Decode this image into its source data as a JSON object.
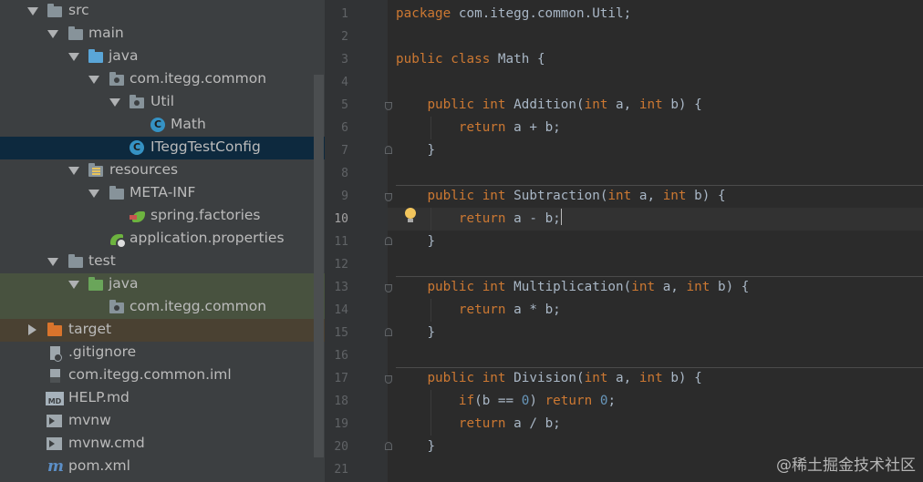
{
  "project_tree": {
    "items": [
      {
        "label": "src",
        "icon": "folder-icon"
      },
      {
        "label": "main",
        "icon": "folder-icon"
      },
      {
        "label": "java",
        "icon": "source-folder-icon"
      },
      {
        "label": "com.itegg.common",
        "icon": "package-icon"
      },
      {
        "label": "Util",
        "icon": "package-icon"
      },
      {
        "label": "Math",
        "icon": "class-icon"
      },
      {
        "label": "ITeggTestConfig",
        "icon": "class-icon"
      },
      {
        "label": "resources",
        "icon": "resources-folder-icon"
      },
      {
        "label": "META-INF",
        "icon": "folder-icon"
      },
      {
        "label": "spring.factories",
        "icon": "spring-factories-icon"
      },
      {
        "label": "application.properties",
        "icon": "spring-properties-icon"
      },
      {
        "label": "test",
        "icon": "folder-icon"
      },
      {
        "label": "java",
        "icon": "test-source-folder-icon"
      },
      {
        "label": "com.itegg.common",
        "icon": "package-icon"
      },
      {
        "label": "target",
        "icon": "excluded-folder-icon"
      },
      {
        "label": ".gitignore",
        "icon": "gitignore-file-icon"
      },
      {
        "label": "com.itegg.common.iml",
        "icon": "iml-file-icon"
      },
      {
        "label": "HELP.md",
        "icon": "markdown-file-icon"
      },
      {
        "label": "mvnw",
        "icon": "terminal-file-icon"
      },
      {
        "label": "mvnw.cmd",
        "icon": "terminal-file-icon"
      },
      {
        "label": "pom.xml",
        "icon": "maven-icon"
      }
    ],
    "selected": "ITeggTestConfig"
  },
  "editor": {
    "line_numbers": [
      "1",
      "2",
      "3",
      "4",
      "5",
      "6",
      "7",
      "8",
      "9",
      "10",
      "11",
      "12",
      "13",
      "14",
      "15",
      "16",
      "17",
      "18",
      "19",
      "20",
      "21"
    ],
    "current_line": "10",
    "code": {
      "l1": {
        "kw": "package",
        "rest": " com.itegg.common.Util;"
      },
      "l3": {
        "kw1": "public",
        "kw2": "class",
        "rest": " Math {"
      },
      "l5": {
        "pub": "public",
        "int": "int",
        "name": "Addition",
        "t1": "int",
        "a": " a, ",
        "t2": "int",
        "b": " b) {"
      },
      "l6": {
        "kw": "return",
        "rest": " a + b;"
      },
      "l7": "}",
      "l9": {
        "pub": "public",
        "int": "int",
        "name": "Subtraction",
        "t1": "int",
        "a": " a, ",
        "t2": "int",
        "b": " b) {"
      },
      "l10": {
        "kw": "return",
        "rest": " a - b;"
      },
      "l11": "}",
      "l13": {
        "pub": "public",
        "int": "int",
        "name": "Multiplication",
        "t1": "int",
        "a": " a, ",
        "t2": "int",
        "b": " b) {"
      },
      "l14": {
        "kw": "return",
        "rest": " a * b;"
      },
      "l15": "}",
      "l17": {
        "pub": "public",
        "int": "int",
        "name": "Division",
        "t1": "int",
        "a": " a, ",
        "t2": "int",
        "b": " b) {"
      },
      "l18": {
        "if": "if",
        "cond": "(b == ",
        "zero": "0",
        "close": ") ",
        "ret": "return",
        "sp": " ",
        "zero2": "0",
        "semi": ";"
      },
      "l19": {
        "kw": "return",
        "rest": " a / b;"
      },
      "l20": "}"
    }
  },
  "watermark": "@稀土掘金技术社区",
  "colors": {
    "keyword": "#cc7832",
    "number": "#6897bb",
    "text": "#a9b7c6",
    "selection": "#0d293e"
  }
}
